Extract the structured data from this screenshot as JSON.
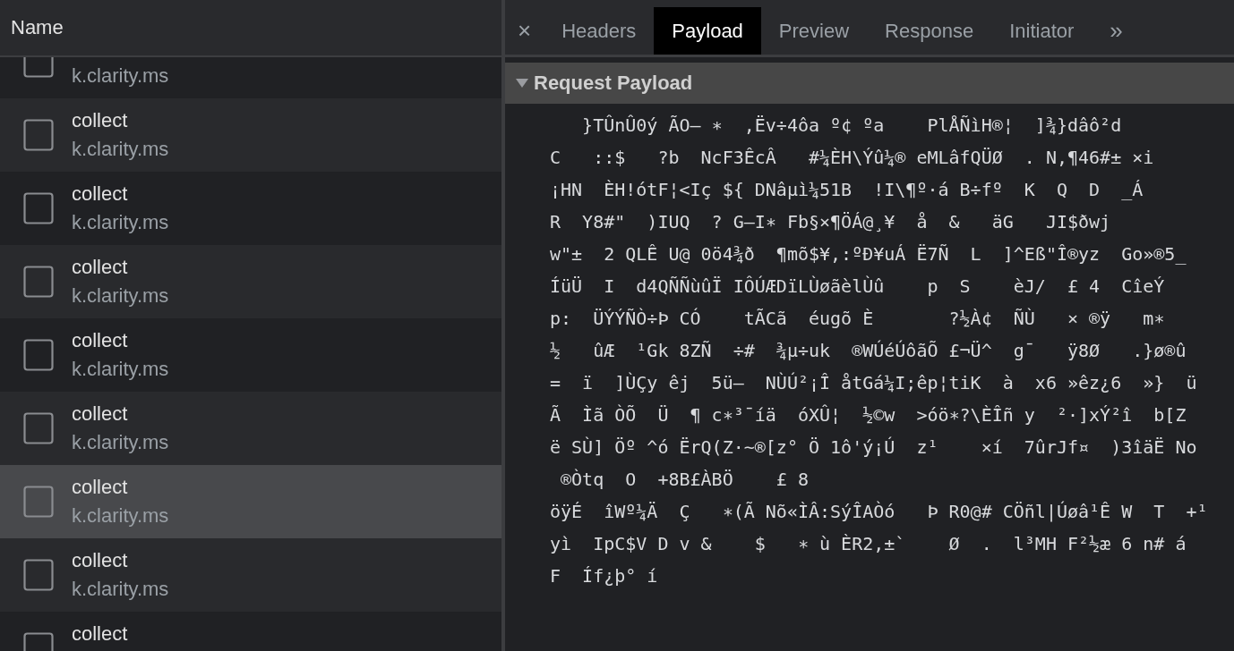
{
  "requests": {
    "column": "Name",
    "rows": [
      {
        "domain": "k.clarity.ms",
        "selected": false
      },
      {
        "name": "collect",
        "domain": "k.clarity.ms",
        "selected": false
      },
      {
        "name": "collect",
        "domain": "k.clarity.ms",
        "selected": false
      },
      {
        "name": "collect",
        "domain": "k.clarity.ms",
        "selected": false
      },
      {
        "name": "collect",
        "domain": "k.clarity.ms",
        "selected": false
      },
      {
        "name": "collect",
        "domain": "k.clarity.ms",
        "selected": false
      },
      {
        "name": "collect",
        "domain": "k.clarity.ms",
        "selected": true
      },
      {
        "name": "collect",
        "domain": "k.clarity.ms",
        "selected": false
      },
      {
        "name": "collect",
        "selected": false
      }
    ]
  },
  "details": {
    "close": "×",
    "more": "»",
    "tabs": [
      {
        "label": "Headers",
        "selected": false
      },
      {
        "label": "Payload",
        "selected": true
      },
      {
        "label": "Preview",
        "selected": false
      },
      {
        "label": "Response",
        "selected": false
      },
      {
        "label": "Initiator",
        "selected": false
      }
    ],
    "section": {
      "title": "Request Payload",
      "expanded": true,
      "lines": [
        "   }TÛnÛ0ý ÃO– ∗  ,Ëv÷4ôa º¢ ºa    PlÅÑìH®¦  ]¾}dâô²d",
        "C   ::$   ?b  NcF3ÊcÂ   #¼ÈH\\Ýû¼® eMLâfQÜØ  . N,¶46#± ×i",
        "¡HN  ÈH!ótF¦<Iç ${ DNâµì¼51B  !I\\¶º·á B÷fº  K  Q  D  _Á",
        "R  Y8#\"  )IUQ  ? G–I∗ Fb§×¶ÖÁ@¸¥  å  &   äG   JI$ðwj",
        "w\"±  2 QLÊ U@ 0ö4¾ð  ¶mõ$¥,:ºÐ¥uÁ Ë7Ñ  L  ]^Eß\"Î®yz  Go»®5_",
        "ÍüÜ  I  d4QÑÑùûÏ IÔÚÆDïLÙøãèlÙû    p  S    èJ/  £ 4  CîeÝ",
        "p:  ÜÝÝÑÒ÷Þ CÓ    tÃCã  éugõ È       ?½À¢  ÑÙ   × ®ÿ   m∗",
        "½   ûÆ  ¹Gk 8ZÑ  ÷#  ¾µ÷uk  ®WÚéÚôãÕ £¬Ü^  g¯   ÿ8Ø   .}ø®û",
        "=  ï  ]ÙÇy êj  5ü–  NÙÚ²¡Î åtGá¼I;êp¦tiK  à  x6 »êz¿6  »}  ü",
        "Ã  Ìã ÒÕ  Ü  ¶ c∗³¯íä  óXÛ¦  ½©w  >óö∗?\\ÈÎñ y  ²·]xÝ²î  b[Z",
        "ë SÙ] Öº ^ó ËrQ(Z·~®[z° Ö 1ô'ý¡Ú  z¹    ×í  7ûrJf¤  )3îäË No",
        " ®Òtq  O  +8B£ÀBÖ    £ 8",
        "öÿÉ  îWº¼Ä  Ç   ∗(Ã Nõ«ÌÂ:SýÎAÒó   Þ R0@# CÖñl|Úøâ¹Ê W  T  +¹",
        "yì  IpC$V D v &    $   ∗ ù ÈR2,±`    Ø  .  l³MH F²½æ 6 n# á",
        "F  Íf¿þ° í"
      ]
    }
  }
}
